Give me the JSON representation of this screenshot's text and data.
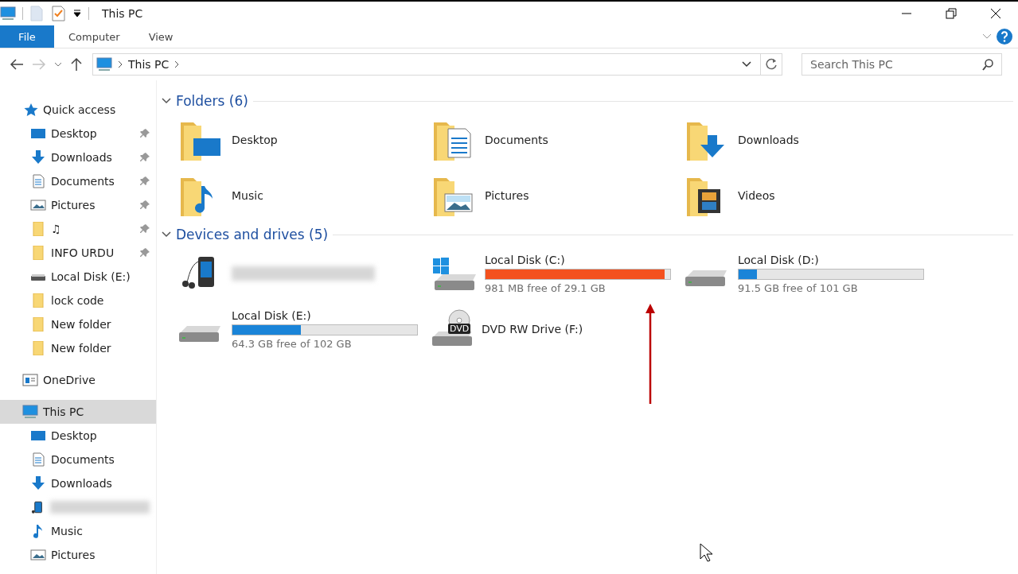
{
  "window": {
    "title": "This PC"
  },
  "ribbon": {
    "tabs": [
      {
        "label": "File",
        "selected": true
      },
      {
        "label": "Computer",
        "selected": false
      },
      {
        "label": "View",
        "selected": false
      }
    ]
  },
  "address": {
    "crumbs": [
      "This PC"
    ],
    "forward_disabled": true
  },
  "search": {
    "placeholder": "Search This PC"
  },
  "sidebar": {
    "items": [
      {
        "label": "Quick access",
        "kind": "star",
        "selected": false,
        "children": [
          {
            "label": "Desktop",
            "kind": "desktop",
            "pinned": true,
            "selected": false
          },
          {
            "label": "Downloads",
            "kind": "download",
            "pinned": true,
            "selected": false
          },
          {
            "label": "Documents",
            "kind": "document",
            "pinned": true,
            "selected": false
          },
          {
            "label": "Pictures",
            "kind": "picture",
            "pinned": true,
            "selected": false
          },
          {
            "label": "♫",
            "kind": "folder",
            "pinned": true,
            "selected": false
          },
          {
            "label": "INFO URDU",
            "kind": "folder",
            "pinned": true,
            "selected": false
          },
          {
            "label": "Local Disk (E:)",
            "kind": "drive",
            "pinned": false,
            "selected": false
          },
          {
            "label": "lock code",
            "kind": "folder",
            "pinned": false,
            "selected": false
          },
          {
            "label": "New folder",
            "kind": "folder",
            "pinned": false,
            "selected": false
          },
          {
            "label": "New folder",
            "kind": "folder",
            "pinned": false,
            "selected": false
          }
        ]
      },
      {
        "label": "OneDrive",
        "kind": "onedrive",
        "selected": false
      },
      {
        "label": "This PC",
        "kind": "pc",
        "selected": true,
        "children": [
          {
            "label": "Desktop",
            "kind": "desktop",
            "selected": false
          },
          {
            "label": "Documents",
            "kind": "document",
            "selected": false
          },
          {
            "label": "Downloads",
            "kind": "download",
            "selected": false
          },
          {
            "kind": "device",
            "selected": false
          },
          {
            "label": "Music",
            "kind": "music",
            "selected": false
          },
          {
            "label": "Pictures",
            "kind": "picture",
            "selected": false
          }
        ]
      }
    ]
  },
  "folders": {
    "title": "Folders (6)",
    "expanded": true,
    "items": [
      {
        "label": "Desktop",
        "kind": "desktop"
      },
      {
        "label": "Documents",
        "kind": "document"
      },
      {
        "label": "Downloads",
        "kind": "download"
      },
      {
        "label": "Music",
        "kind": "music"
      },
      {
        "label": "Pictures",
        "kind": "picture"
      },
      {
        "label": "Videos",
        "kind": "video"
      }
    ]
  },
  "drives": {
    "title": "Devices and drives (5)",
    "expanded": true,
    "items": [
      {
        "kind": "device"
      },
      {
        "kind": "disk",
        "label": "Local Disk (C:)",
        "system": true,
        "level": 0.97,
        "color": "#f4511e",
        "reading": "981 MB free of 29.1 GB"
      },
      {
        "kind": "disk",
        "label": "Local Disk (D:)",
        "system": false,
        "level": 0.1,
        "color": "#1a84d8",
        "reading": "91.5 GB free of 101 GB"
      },
      {
        "kind": "disk",
        "label": "Local Disk (E:)",
        "system": false,
        "level": 0.37,
        "color": "#1a84d8",
        "reading": "64.3 GB free of 102 GB"
      },
      {
        "kind": "dvd",
        "label": "DVD RW Drive (F:)",
        "badge": "DVD"
      }
    ]
  }
}
